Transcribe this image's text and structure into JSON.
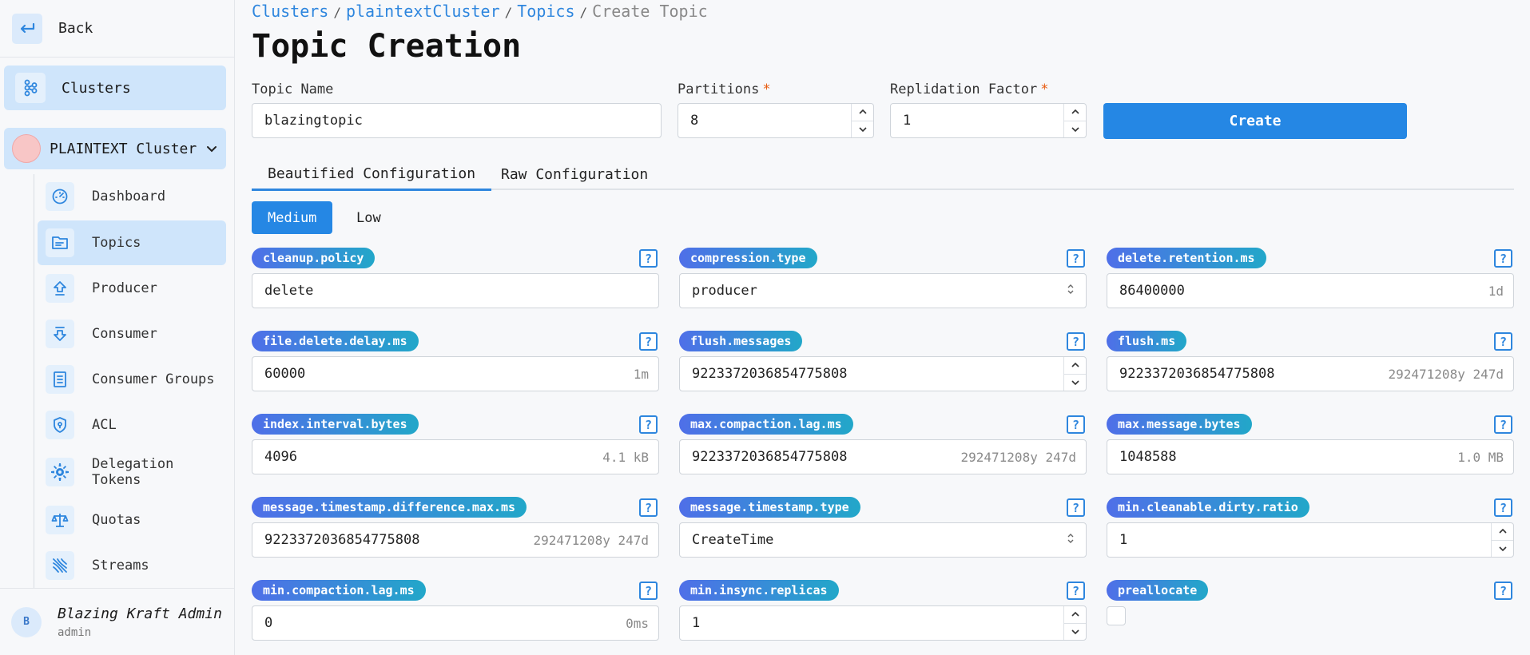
{
  "sidebar": {
    "back_label": "Back",
    "clusters_label": "Clusters",
    "cluster_name": "PLAINTEXT Cluster",
    "items": [
      {
        "label": "Dashboard",
        "icon": "gauge-icon",
        "active": false
      },
      {
        "label": "Topics",
        "icon": "topic-list-icon",
        "active": true
      },
      {
        "label": "Producer",
        "icon": "producer-upload-icon",
        "active": false
      },
      {
        "label": "Consumer",
        "icon": "consumer-download-icon",
        "active": false
      },
      {
        "label": "Consumer Groups",
        "icon": "consumer-groups-icon",
        "active": false
      },
      {
        "label": "ACL",
        "icon": "shield-icon",
        "active": false
      },
      {
        "label": "Delegation Tokens",
        "icon": "token-gear-icon",
        "active": false
      },
      {
        "label": "Quotas",
        "icon": "scales-icon",
        "active": false
      },
      {
        "label": "Streams",
        "icon": "streams-icon",
        "active": false
      }
    ],
    "user": {
      "initial": "B",
      "name": "Blazing Kraft Admin",
      "role": "admin"
    }
  },
  "breadcrumb": {
    "items": [
      "Clusters",
      "plaintextCluster",
      "Topics"
    ],
    "current": "Create Topic",
    "separator": "/"
  },
  "page_title": "Topic Creation",
  "form": {
    "topic_name": {
      "label": "Topic Name",
      "value": "blazingtopic"
    },
    "partitions": {
      "label": "Partitions",
      "required": "*",
      "value": "8"
    },
    "replication": {
      "label": "Replidation Factor",
      "required": "*",
      "value": "1"
    },
    "create_label": "Create"
  },
  "tabs": [
    "Beautified Configuration",
    "Raw Configuration"
  ],
  "levels": [
    "Medium",
    "Low"
  ],
  "help_glyph": "?",
  "configs": [
    {
      "key": "cleanup.policy",
      "value": "delete",
      "hint": "",
      "control": "text"
    },
    {
      "key": "compression.type",
      "value": "producer",
      "hint": "",
      "control": "select"
    },
    {
      "key": "delete.retention.ms",
      "value": "86400000",
      "hint": "1d",
      "control": "text"
    },
    {
      "key": "file.delete.delay.ms",
      "value": "60000",
      "hint": "1m",
      "control": "text"
    },
    {
      "key": "flush.messages",
      "value": "9223372036854775808",
      "hint": "",
      "control": "number"
    },
    {
      "key": "flush.ms",
      "value": "9223372036854775808",
      "hint": "292471208y 247d",
      "control": "text"
    },
    {
      "key": "index.interval.bytes",
      "value": "4096",
      "hint": "4.1 kB",
      "control": "text"
    },
    {
      "key": "max.compaction.lag.ms",
      "value": "9223372036854775808",
      "hint": "292471208y 247d",
      "control": "text"
    },
    {
      "key": "max.message.bytes",
      "value": "1048588",
      "hint": "1.0 MB",
      "control": "text"
    },
    {
      "key": "message.timestamp.difference.max.ms",
      "value": "9223372036854775808",
      "hint": "292471208y 247d",
      "control": "text"
    },
    {
      "key": "message.timestamp.type",
      "value": "CreateTime",
      "hint": "",
      "control": "select"
    },
    {
      "key": "min.cleanable.dirty.ratio",
      "value": "1",
      "hint": "",
      "control": "number"
    },
    {
      "key": "min.compaction.lag.ms",
      "value": "0",
      "hint": "0ms",
      "control": "text"
    },
    {
      "key": "min.insync.replicas",
      "value": "1",
      "hint": "",
      "control": "number"
    },
    {
      "key": "preallocate",
      "value": "",
      "hint": "",
      "control": "checkbox"
    }
  ],
  "colors": {
    "accent": "#2587e4",
    "active_bg": "#cfe5fb",
    "badge_start": "#4f6fe8",
    "badge_end": "#22a7c9"
  }
}
